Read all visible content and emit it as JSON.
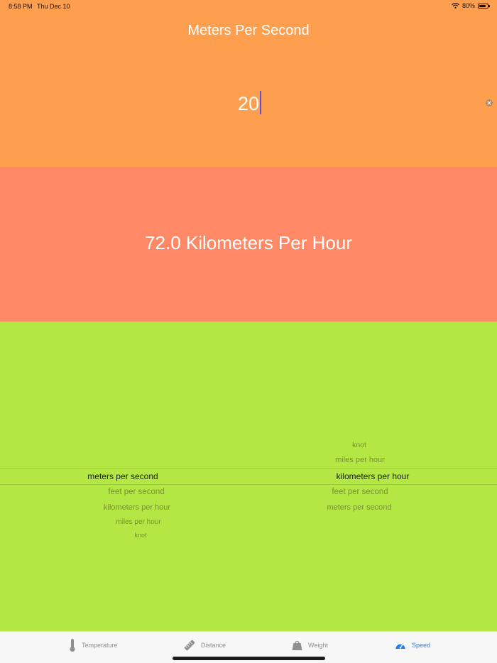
{
  "status_bar": {
    "time": "8:58 PM",
    "date": "Thu Dec 10",
    "battery": "80%",
    "battery_level": 0.8
  },
  "colors": {
    "input_bg": "#FE9F50",
    "result_bg": "#FF8967",
    "picker_bg": "#B2E744",
    "tab_active": "#1A7EF2",
    "tab_inactive": "#8E8E93"
  },
  "input": {
    "title": "Meters Per Second",
    "value": "20"
  },
  "result": {
    "text": "72.0 Kilometers Per Hour"
  },
  "picker": {
    "from": {
      "selected": "meters per second",
      "below": [
        "feet per second",
        "kilometers per hour",
        "miles per hour",
        "knot"
      ]
    },
    "to": {
      "above": [
        "knot",
        "miles per hour"
      ],
      "selected": "kilometers per hour",
      "below": [
        "feet per second",
        "meters per second"
      ]
    }
  },
  "tabs": [
    {
      "label": "Temperature",
      "icon": "thermometer-icon",
      "active": false
    },
    {
      "label": "Distance",
      "icon": "ruler-icon",
      "active": false
    },
    {
      "label": "Weight",
      "icon": "weight-icon",
      "active": false
    },
    {
      "label": "Speed",
      "icon": "speedometer-icon",
      "active": true
    }
  ]
}
